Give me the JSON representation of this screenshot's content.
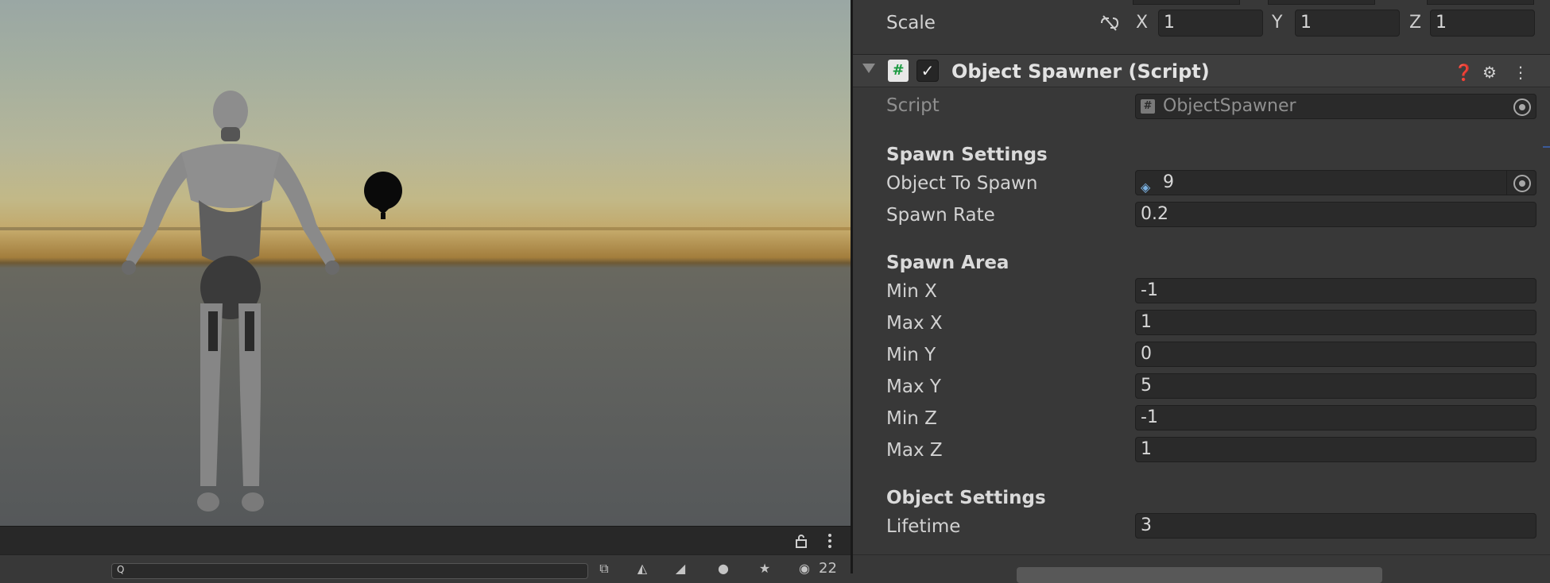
{
  "scene": {
    "search_placeholder": "",
    "search_value": "Q",
    "hidden_count": "22"
  },
  "inspector": {
    "scale": {
      "label": "Scale",
      "x_label": "X",
      "x": "1",
      "y_label": "Y",
      "y": "1",
      "z_label": "Z",
      "z": "1"
    },
    "component": {
      "title": "Object Spawner (Script)",
      "script_label": "Script",
      "script_value": "ObjectSpawner"
    },
    "spawn_settings": {
      "header": "Spawn Settings",
      "object_label": "Object To Spawn",
      "object_value": "9",
      "rate_label": "Spawn Rate",
      "rate_value": "0.2"
    },
    "spawn_area": {
      "header": "Spawn Area",
      "min_x_label": "Min X",
      "min_x": "-1",
      "max_x_label": "Max X",
      "max_x": "1",
      "min_y_label": "Min Y",
      "min_y": "0",
      "max_y_label": "Max Y",
      "max_y": "5",
      "min_z_label": "Min Z",
      "min_z": "-1",
      "max_z_label": "Max Z",
      "max_z": "1"
    },
    "object_settings": {
      "header": "Object Settings",
      "lifetime_label": "Lifetime",
      "lifetime_value": "3"
    }
  },
  "colors": {
    "panel_bg": "#383838",
    "field_bg": "#2a2a2a",
    "script_icon": "#1a9a40"
  }
}
